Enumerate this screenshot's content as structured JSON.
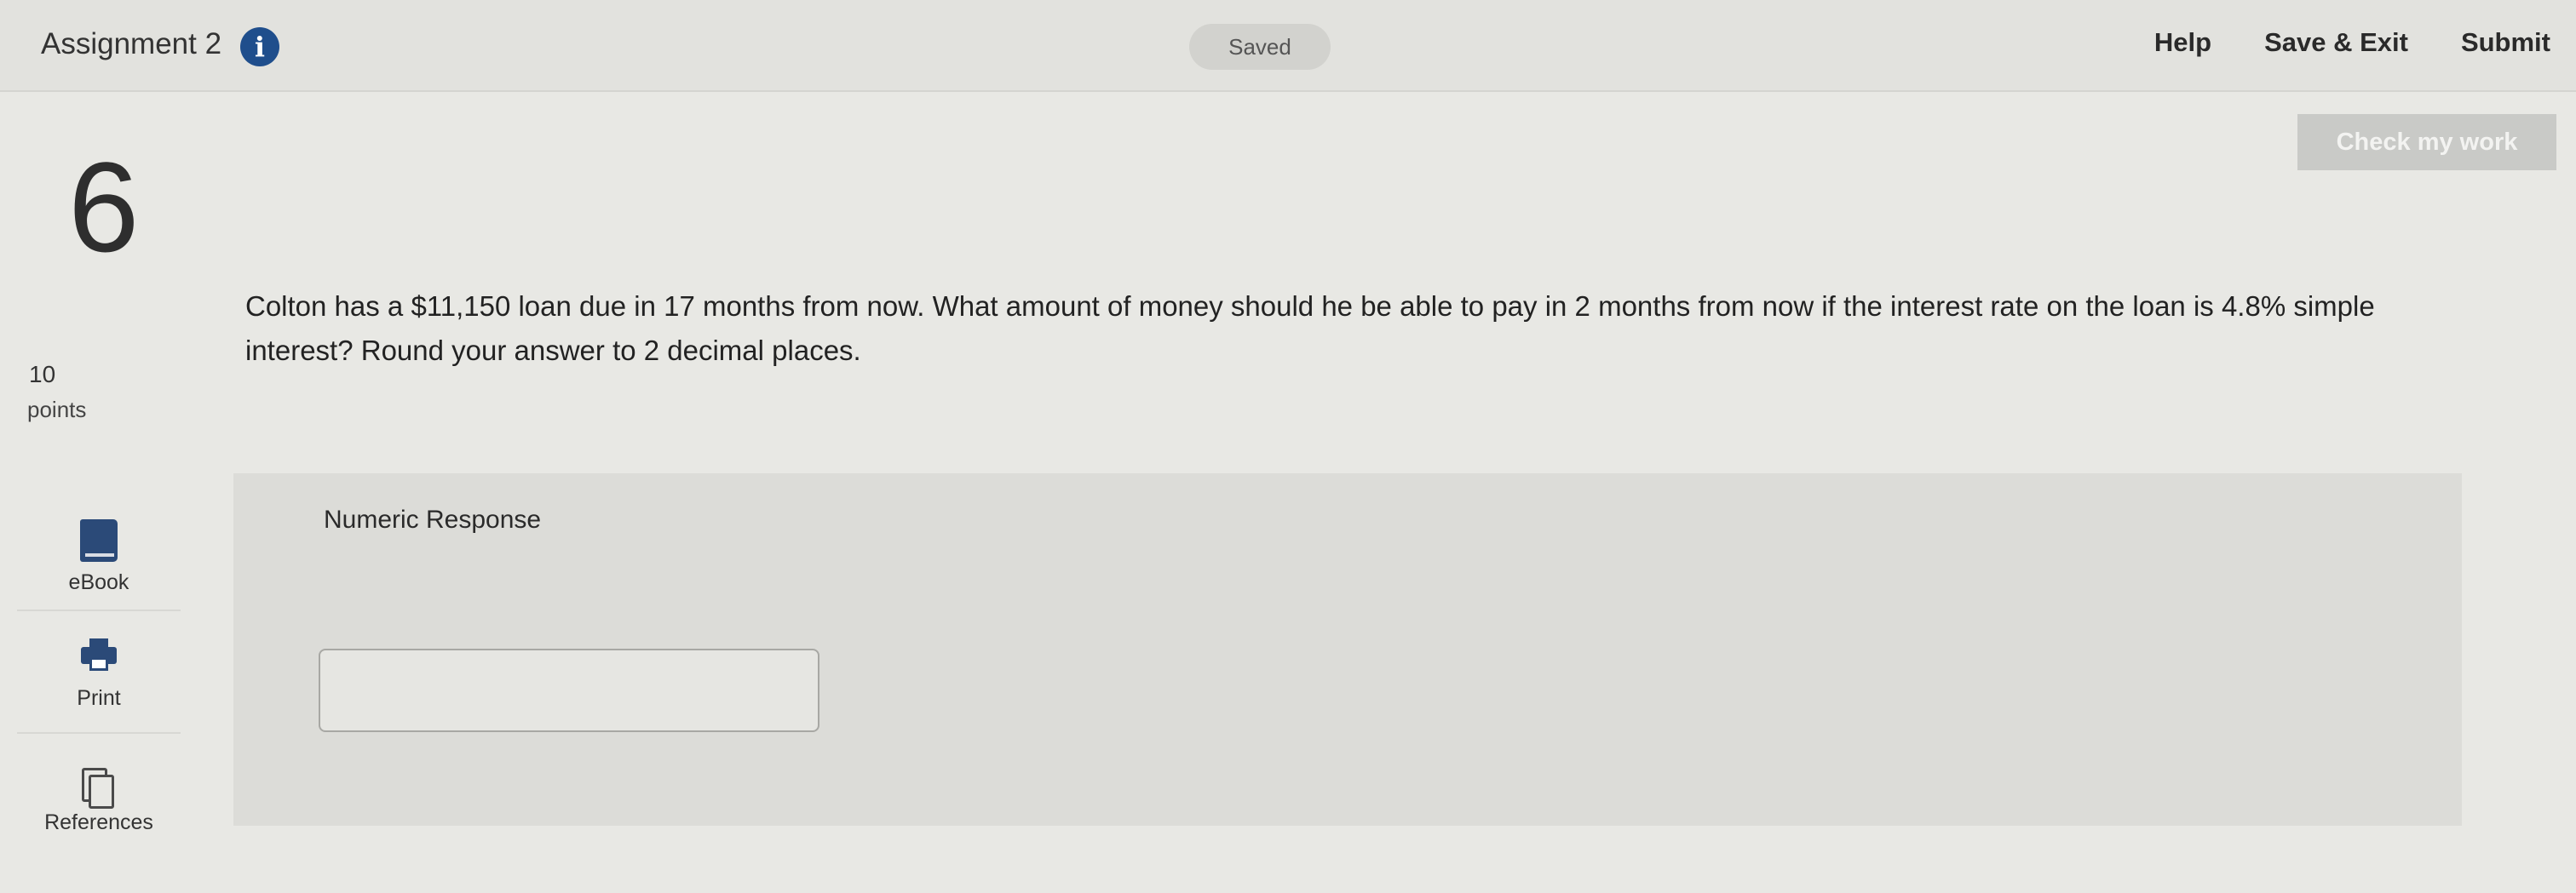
{
  "header": {
    "assignment_title": "Assignment 2",
    "saved_status": "Saved",
    "links": {
      "help": "Help",
      "save_exit": "Save & Exit",
      "submit": "Submit"
    }
  },
  "actions": {
    "check_my_work": "Check my work"
  },
  "question": {
    "number": "6",
    "points_value": "10",
    "points_label": "points",
    "text": "Colton has a $11,150 loan due in 17 months from now. What amount of money should he be able to pay in 2 months from now if the interest rate on the loan is 4.8% simple interest? Round your answer to 2 decimal places."
  },
  "tools": [
    {
      "label": "eBook",
      "icon": "book-icon"
    },
    {
      "label": "Print",
      "icon": "printer-icon"
    },
    {
      "label": "References",
      "icon": "references-icon"
    }
  ],
  "response": {
    "label": "Numeric Response",
    "answer_value": ""
  },
  "colors": {
    "accent": "#1f4e8c",
    "background": "#e8e8e4",
    "panel": "#dcdcd8",
    "disabled_button": "#c9cac7"
  }
}
